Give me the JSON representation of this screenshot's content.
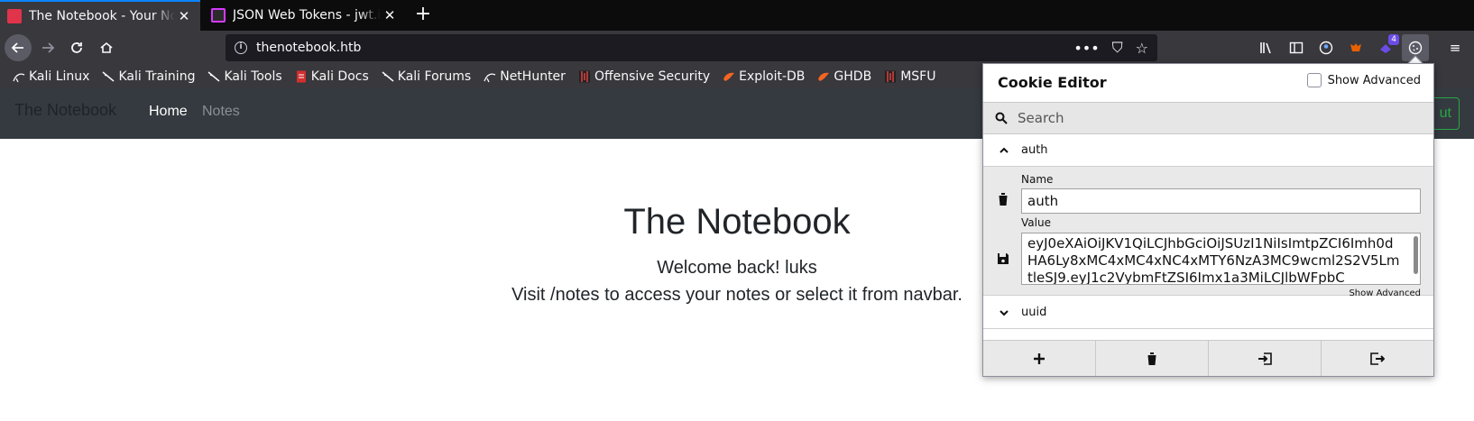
{
  "browser": {
    "tabs": [
      {
        "title": "The Notebook - Your Notes",
        "close": "✕",
        "favicon_color": "#e0344b"
      },
      {
        "title": "JSON Web Tokens - jwt.io",
        "close": "✕",
        "favicon_color": "#d63aff"
      }
    ],
    "new_tab": "+",
    "url": "thenotebook.htb",
    "url_actions": {
      "more": "•••",
      "pocket": "⛉",
      "star": "☆"
    },
    "toolbar": {
      "extension_badge": "4"
    },
    "menu": "≡"
  },
  "bookmarks": [
    {
      "label": "Kali Linux",
      "icon": "kali-dragon-icon"
    },
    {
      "label": "Kali Training",
      "icon": "kali-dragon-icon"
    },
    {
      "label": "Kali Tools",
      "icon": "kali-dragon-icon"
    },
    {
      "label": "Kali Docs",
      "icon": "kali-docs-icon"
    },
    {
      "label": "Kali Forums",
      "icon": "kali-dragon-icon"
    },
    {
      "label": "NetHunter",
      "icon": "kali-dragon-icon"
    },
    {
      "label": "Offensive Security",
      "icon": "offsec-icon"
    },
    {
      "label": "Exploit-DB",
      "icon": "exploitdb-icon"
    },
    {
      "label": "GHDB",
      "icon": "exploitdb-icon"
    },
    {
      "label": "MSFU",
      "icon": "offsec-icon"
    }
  ],
  "site": {
    "brand": "The Notebook",
    "nav_home": "Home",
    "nav_notes": "Notes",
    "logout_partial": "ut",
    "title": "The Notebook",
    "welcome": "Welcome back! luks",
    "instructions": "Visit /notes to access your notes or select it from navbar."
  },
  "cookie_editor": {
    "title": "Cookie Editor",
    "show_advanced": "Show Advanced",
    "search_placeholder": "Search",
    "cookies": [
      {
        "name": "auth",
        "expanded": true
      },
      {
        "name": "uuid",
        "expanded": false
      }
    ],
    "name_label": "Name",
    "name_value": "auth",
    "value_label": "Value",
    "value_text": "eyJ0eXAiOiJKV1QiLCJhbGciOiJSUzI1NiIsImtpZCI6Imh0dHA6Ly8xMC4xMC4xNC4xMTY6NzA3MC9wcml2S2V5LmtleSJ9.eyJ1c2VybmFtZSI6Imx1a3MiLCJlbWFpbC",
    "show_advanced_link": "Show Advanced"
  },
  "colors": {
    "tab_active_accent": "#0a84ff",
    "site_navbar": "#343a40",
    "logout_green": "#28a745",
    "extension_badge": "#6b4ce6"
  }
}
